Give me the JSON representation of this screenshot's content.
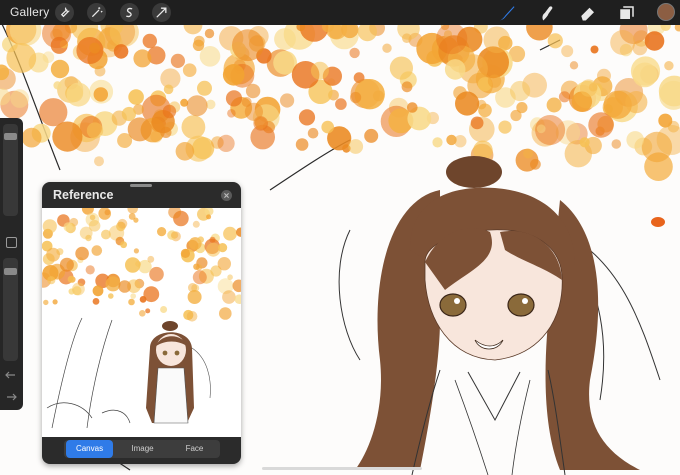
{
  "toolbar": {
    "gallery_label": "Gallery",
    "left_tools": [
      "wrench-icon",
      "magic-wand-icon",
      "selection-icon",
      "transform-icon"
    ],
    "right_tools": [
      "brush-icon",
      "smudge-icon",
      "eraser-icon",
      "layers-icon"
    ],
    "active_tool": "brush-icon",
    "active_color": "#8c5e43",
    "accent_color": "#2f7be8"
  },
  "sidebar": {
    "brush_size_level": 0.1,
    "opacity_level": 0.1
  },
  "reference": {
    "title": "Reference",
    "tabs": [
      "Canvas",
      "Image",
      "Face"
    ],
    "active_tab": "Canvas"
  }
}
